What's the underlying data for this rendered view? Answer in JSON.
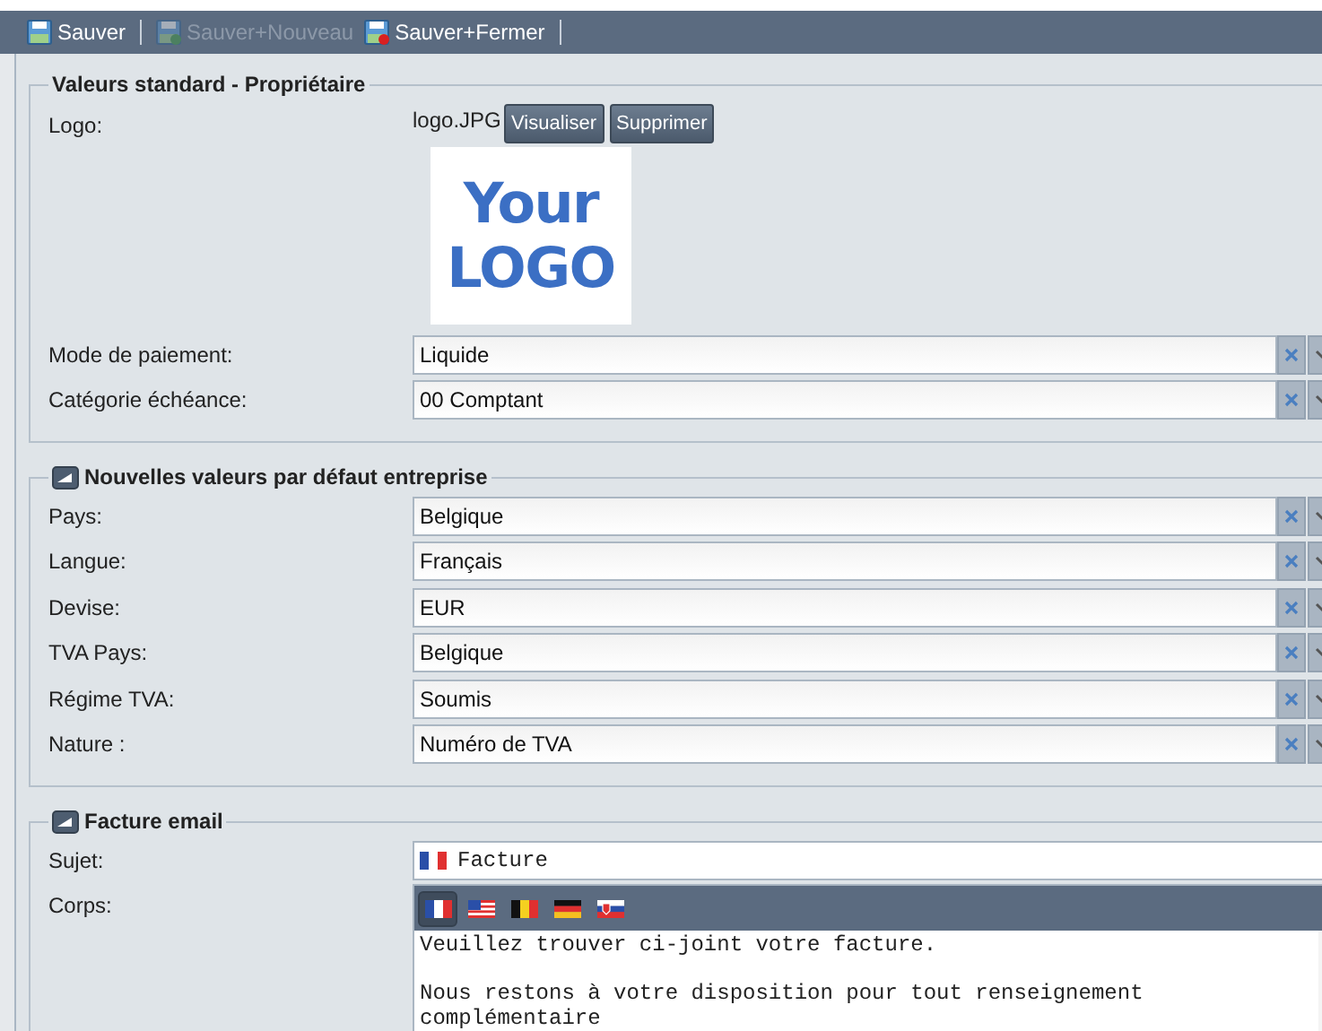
{
  "toolbar": [
    {
      "label": "Sauver",
      "kind": "save",
      "disabled": false
    },
    {
      "label": "Sauver+Nouveau",
      "kind": "save-new",
      "disabled": true
    },
    {
      "label": "Sauver+Fermer",
      "kind": "save-close",
      "disabled": false
    }
  ],
  "sections": [
    {
      "title": "Valeurs standard - Propriétaire",
      "collapsible": false,
      "logo": {
        "label": "Logo:",
        "file": "logo.JPG",
        "buttons": [
          "Visualiser",
          "Supprimer"
        ],
        "image_text": [
          "Your",
          "LOGO"
        ]
      },
      "fields": [
        {
          "label": "Mode de paiement:",
          "value": "Liquide"
        },
        {
          "label": "Catégorie échéance:",
          "value": "00 Comptant"
        }
      ]
    },
    {
      "title": "Nouvelles valeurs par défaut entreprise",
      "collapsible": true,
      "fields": [
        {
          "label": "Pays:",
          "value": "Belgique"
        },
        {
          "label": "Langue:",
          "value": "Français"
        },
        {
          "label": "Devise:",
          "value": "EUR"
        },
        {
          "label": "TVA Pays:",
          "value": "Belgique"
        },
        {
          "label": "Régime TVA:",
          "value": "Soumis"
        },
        {
          "label": "Nature :",
          "value": "Numéro de TVA"
        }
      ]
    },
    {
      "title": "Facture email",
      "collapsible": true,
      "email": {
        "subject_label": "Sujet:",
        "subject_flag": {
          "kind": "fr"
        },
        "subject": "Facture",
        "body_label": "Corps:",
        "languages": [
          {
            "kind": "fr",
            "selected": true
          },
          {
            "kind": "us",
            "selected": false
          },
          {
            "kind": "be",
            "selected": false
          },
          {
            "kind": "de",
            "selected": false
          },
          {
            "kind": "sk",
            "selected": false
          }
        ],
        "body": "Veuillez trouver ci-joint votre facture.\n\nNous restons à votre disposition pour tout renseignement\ncomplémentaire"
      }
    }
  ]
}
